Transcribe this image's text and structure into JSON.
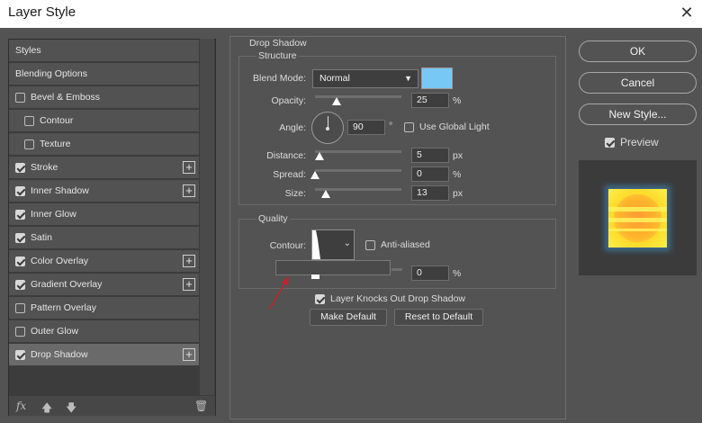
{
  "window": {
    "title": "Layer Style"
  },
  "colors": {
    "shadow_color": "#78c8f6",
    "accent_arrow": "#c0252b"
  },
  "styles_list": [
    {
      "label": "Styles",
      "checkbox": false,
      "checked": false,
      "plus": false
    },
    {
      "label": "Blending Options",
      "checkbox": false,
      "checked": false,
      "plus": false
    },
    {
      "label": "Bevel & Emboss",
      "checkbox": true,
      "checked": false,
      "plus": false
    },
    {
      "label": "Contour",
      "checkbox": true,
      "checked": false,
      "plus": false
    },
    {
      "label": "Texture",
      "checkbox": true,
      "checked": false,
      "plus": false
    },
    {
      "label": "Stroke",
      "checkbox": true,
      "checked": true,
      "plus": true
    },
    {
      "label": "Inner Shadow",
      "checkbox": true,
      "checked": true,
      "plus": true
    },
    {
      "label": "Inner Glow",
      "checkbox": true,
      "checked": true,
      "plus": false
    },
    {
      "label": "Satin",
      "checkbox": true,
      "checked": true,
      "plus": false
    },
    {
      "label": "Color Overlay",
      "checkbox": true,
      "checked": true,
      "plus": true
    },
    {
      "label": "Gradient Overlay",
      "checkbox": true,
      "checked": true,
      "plus": true
    },
    {
      "label": "Pattern Overlay",
      "checkbox": true,
      "checked": false,
      "plus": false
    },
    {
      "label": "Outer Glow",
      "checkbox": true,
      "checked": false,
      "plus": false
    },
    {
      "label": "Drop Shadow",
      "checkbox": true,
      "checked": true,
      "plus": true
    }
  ],
  "bottom_icons": {
    "fx": "fx",
    "up": "arrow-up-icon",
    "down": "arrow-down-icon",
    "trash": "trash-icon"
  },
  "drop_shadow": {
    "title": "Drop Shadow",
    "structure": {
      "title": "Structure",
      "blend_mode_label": "Blend Mode:",
      "blend_mode_value": "Normal",
      "opacity_label": "Opacity:",
      "opacity_value": "25",
      "opacity_unit": "%",
      "opacity_fraction": 0.25,
      "angle_label": "Angle:",
      "angle_value": "90",
      "angle_unit": "°",
      "use_global_light_label": "Use Global Light",
      "use_global_light_checked": false,
      "distance_label": "Distance:",
      "distance_value": "5",
      "distance_unit": "px",
      "spread_label": "Spread:",
      "spread_value": "0",
      "spread_unit": "%",
      "size_label": "Size:",
      "size_value": "13",
      "size_unit": "px"
    },
    "quality": {
      "title": "Quality",
      "contour_label": "Contour:",
      "anti_aliased_label": "Anti-aliased",
      "anti_aliased_checked": false,
      "noise_value": "0",
      "noise_unit": "%"
    },
    "knocks_out_label": "Layer Knocks Out Drop Shadow",
    "knocks_out_checked": true,
    "make_default": "Make Default",
    "reset_default": "Reset to Default"
  },
  "right": {
    "ok": "OK",
    "cancel": "Cancel",
    "new_style": "New Style...",
    "preview_label": "Preview",
    "preview_checked": true
  }
}
